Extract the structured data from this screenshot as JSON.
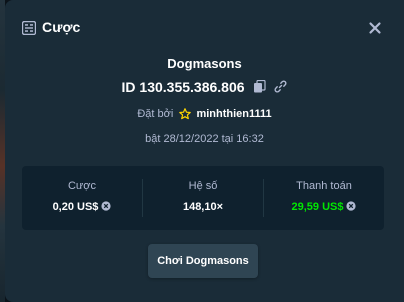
{
  "modal": {
    "title": "Cược",
    "header_icon": "bet-slip-icon",
    "close_icon": "close-icon"
  },
  "bet": {
    "game_name": "Dogmasons",
    "id_text": "ID 130.355.386.806",
    "copy_icon": "copy-icon",
    "link_icon": "link-icon",
    "placed_by_label": "Đặt bởi",
    "rank_icon": "star-icon",
    "username": "minhthien1111",
    "date_text": "bật 28/12/2022 tại 16:32"
  },
  "stats": {
    "bet_label": "Cược",
    "bet_value": "0,20 US$",
    "multiplier_label": "Hệ số",
    "multiplier_value": "148,10×",
    "payout_label": "Thanh toán",
    "payout_value": "29,59 US$",
    "currency_icon": "currency-coin-icon"
  },
  "actions": {
    "play_label": "Chơi Dogmasons"
  },
  "colors": {
    "modal_bg": "#1a2c38",
    "stats_bg": "#0f212e",
    "button_bg": "#2f4553",
    "muted_text": "#b1bad3",
    "payout_green": "#00e701",
    "star_gold": "#ffd700"
  }
}
